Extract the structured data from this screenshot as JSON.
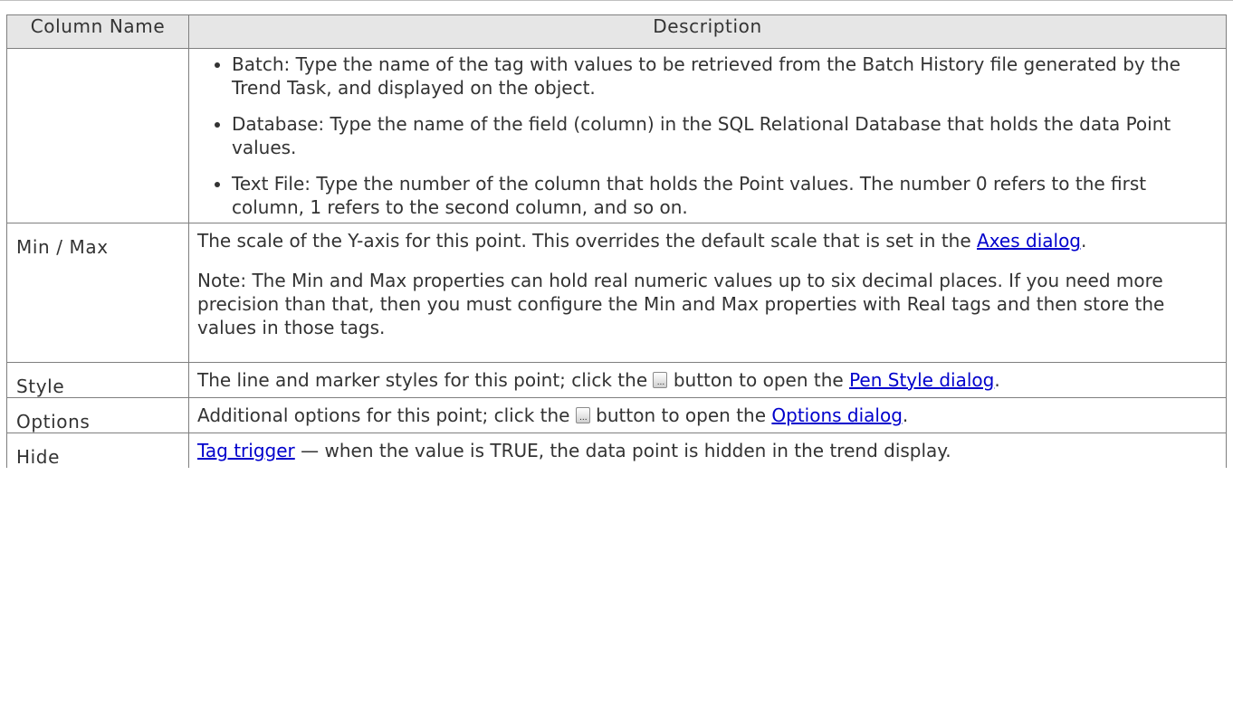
{
  "table": {
    "headers": {
      "column_name": "Column Name",
      "description": "Description"
    },
    "first_row": {
      "name": "",
      "items": [
        "Batch: Type the name of the tag with values to be retrieved from the Batch History file generated by the Trend Task, and displayed on the object.",
        "Database: Type the name of the field (column) in the SQL Relational Database that holds the data Point values.",
        "Text File: Type the number of the column that holds the Point values. The number 0 refers to the first column, 1 refers to the second column, and so on."
      ]
    },
    "min_max": {
      "name": "Min / Max",
      "text_before": "The scale of the Y-axis for this point. This overrides the default scale that is set in the ",
      "link": "Axes dialog",
      "text_after": ".",
      "note": "Note: The Min and Max properties can hold real numeric values up to six decimal places. If you need more precision than that, then you must configure the Min and Max properties with Real tags and then store the values in those tags."
    },
    "style": {
      "name": "Style",
      "text_before": "The line and marker styles for this point; click the ",
      "button_icon": "ellipsis-button-icon",
      "text_middle": " button to open the ",
      "link": "Pen Style dialog",
      "text_after": "."
    },
    "options": {
      "name": "Options",
      "text_before": "Additional options for this point; click the ",
      "button_icon": "ellipsis-button-icon",
      "text_middle": " button to open the ",
      "link": "Options dialog",
      "text_after": "."
    },
    "hide": {
      "name": "Hide",
      "link": "Tag trigger",
      "text_after": " — when the value is TRUE, the data point is hidden in the trend display."
    }
  },
  "colors": {
    "link": "#0000cc",
    "header_background": "#e6e6e6",
    "border": "#7f7f7f",
    "text": "#333333"
  }
}
